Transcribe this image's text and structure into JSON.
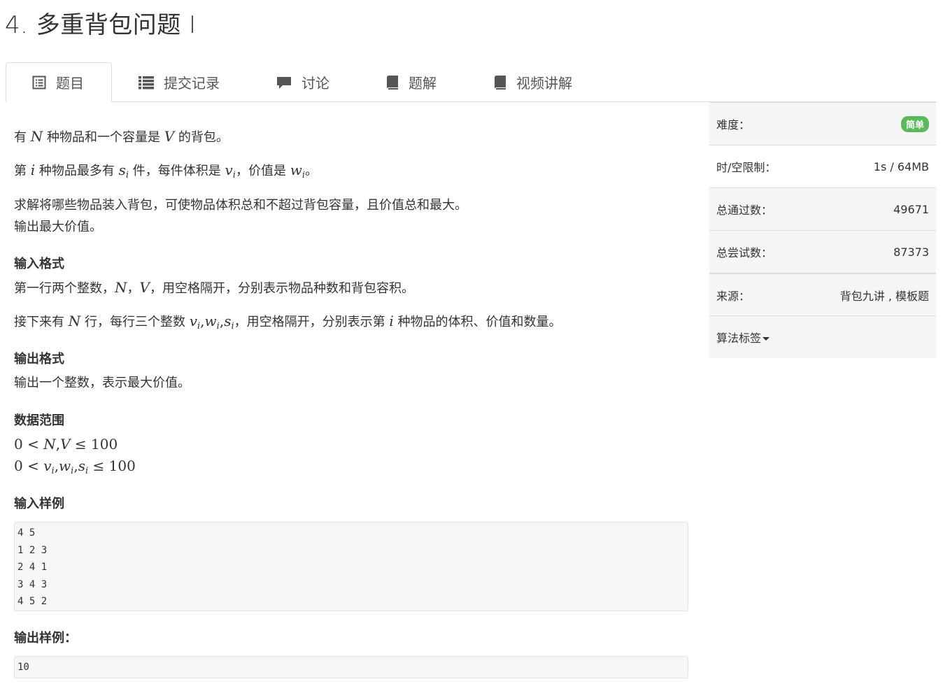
{
  "page": {
    "title": "4. 多重背包问题 I"
  },
  "tabs": [
    {
      "label": "题目",
      "icon": "list-alt-icon",
      "active": true
    },
    {
      "label": "提交记录",
      "icon": "list-icon",
      "active": false
    },
    {
      "label": "讨论",
      "icon": "comment-icon",
      "active": false
    },
    {
      "label": "题解",
      "icon": "book-icon",
      "active": false
    },
    {
      "label": "视频讲解",
      "icon": "book-icon",
      "active": false
    }
  ],
  "problem": {
    "p1": {
      "a": "有 ",
      "m1": "N",
      "b": " 种物品和一个容量是 ",
      "m2": "V",
      "c": " 的背包。"
    },
    "p2": {
      "a": "第 ",
      "m1": "i",
      "b": " 种物品最多有 ",
      "m2": "s",
      "m2sub": "i",
      "c": " 件，每件体积是 ",
      "m3": "v",
      "m3sub": "i",
      "d": "，价值是 ",
      "m4": "w",
      "m4sub": "i",
      "e": "。"
    },
    "p3": {
      "line1": "求解将哪些物品装入背包，可使物品体积总和不超过背包容量，且价值总和最大。",
      "line2": "输出最大价值。"
    },
    "input_heading": "输入格式",
    "input_p1": {
      "a": "第一行两个整数，",
      "m1": "N",
      "sep": "，",
      "m2": "V",
      "b": "，用空格隔开，分别表示物品种数和背包容积。"
    },
    "input_p2": {
      "a": "接下来有 ",
      "m1": "N",
      "b": " 行，每行三个整数 ",
      "v": "v",
      "w": "w",
      "s": "s",
      "sub": "i",
      "comma": ",",
      "c": "，用空格隔开，分别表示第 ",
      "m2": "i",
      "d": " 种物品的体积、价值和数量。"
    },
    "output_heading": "输出格式",
    "output_text": "输出一个整数，表示最大价值。",
    "range_heading": "数据范围",
    "range1": {
      "a": "0 < ",
      "n": "N",
      "comma": ",",
      "v": "V",
      "b": " ≤ 100"
    },
    "range2": {
      "a": "0 < ",
      "v": "v",
      "w": "w",
      "s": "s",
      "sub": "i",
      "comma": ",",
      "b": " ≤ 100"
    },
    "sample_in_heading": "输入样例",
    "sample_in": [
      "4 5",
      "1 2 3",
      "2 4 1",
      "3 4 3",
      "4 5 2"
    ],
    "sample_out_heading": "输出样例：",
    "sample_out": [
      "10"
    ]
  },
  "sidebar": {
    "difficulty_label": "难度：",
    "difficulty_value": "简单",
    "difficulty_color": "#5cb85c",
    "limit_label": "时/空限制：",
    "limit_value": "1s / 64MB",
    "passed_label": "总通过数：",
    "passed_value": "49671",
    "tried_label": "总尝试数：",
    "tried_value": "87373",
    "source_label": "来源：",
    "source_value": "背包九讲 , 模板题",
    "tags_label": "算法标签"
  }
}
